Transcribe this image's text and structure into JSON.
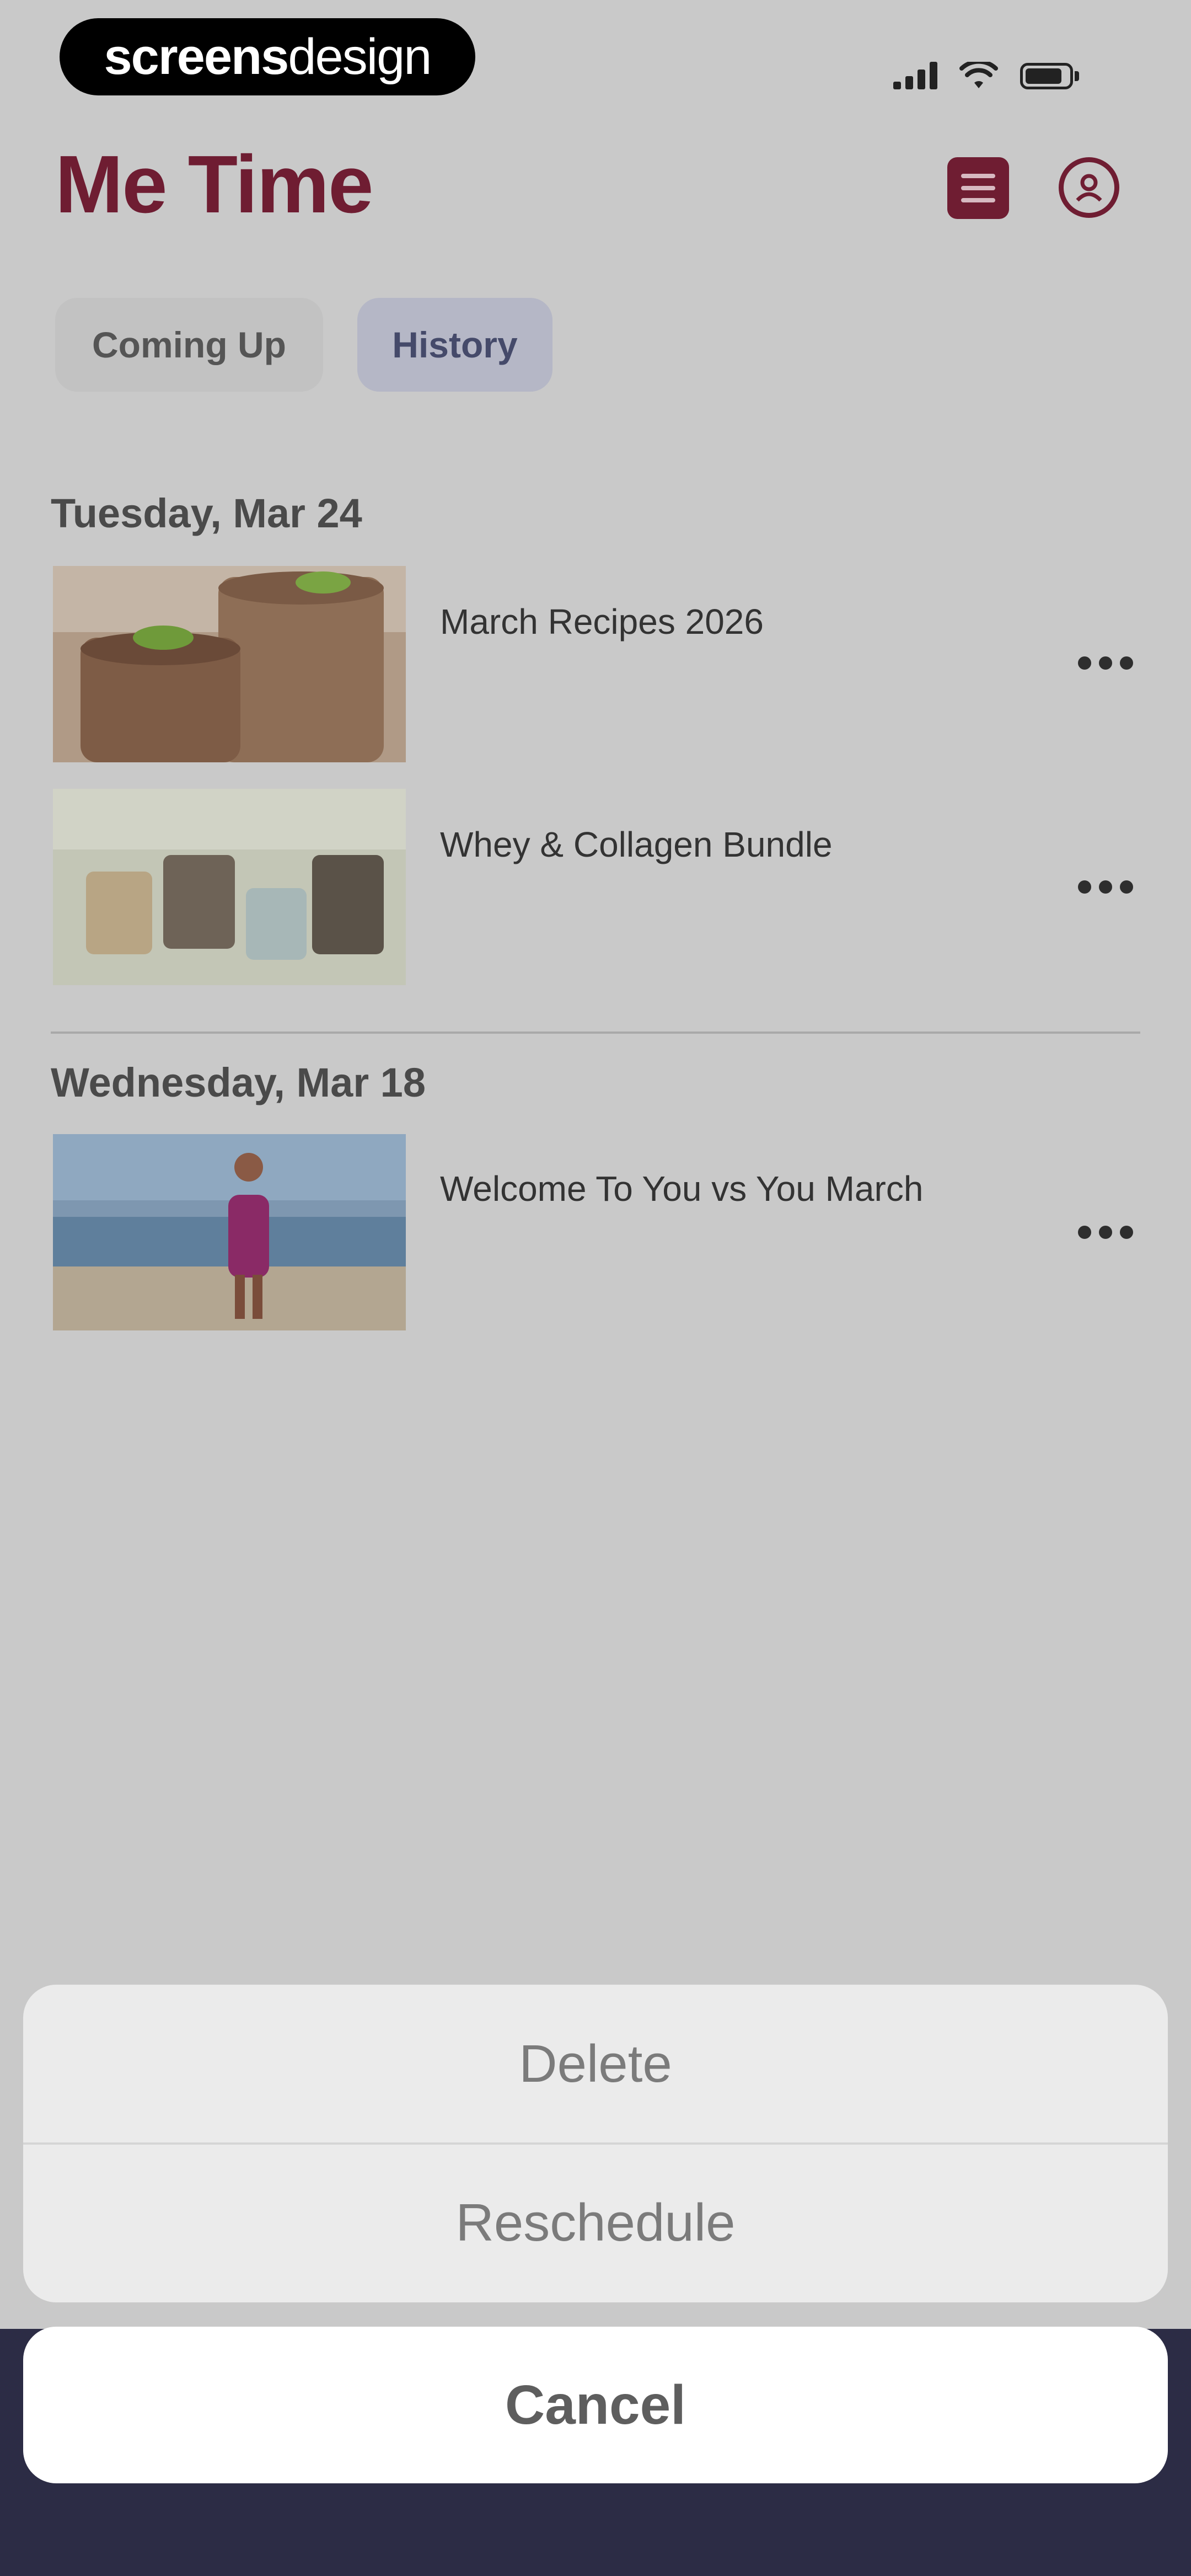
{
  "status_bar": {
    "brand_bold": "screens",
    "brand_regular": "design"
  },
  "header": {
    "title": "Me Time",
    "list_icon": "list-icon",
    "profile_icon": "profile-icon"
  },
  "tabs": [
    {
      "label": "Coming Up",
      "selected": false
    },
    {
      "label": "History",
      "selected": true
    }
  ],
  "sections": [
    {
      "date": "Tuesday, Mar 24",
      "items": [
        {
          "title": "March Recipes 2026",
          "thumb": "smoothie-photo"
        },
        {
          "title": "Whey & Collagen Bundle",
          "thumb": "protein-bags-photo"
        }
      ]
    },
    {
      "date": "Wednesday, Mar 18",
      "items": [
        {
          "title": "Welcome To You vs You March",
          "thumb": "beach-woman-photo"
        }
      ]
    }
  ],
  "action_sheet": {
    "delete": "Delete",
    "reschedule": "Reschedule",
    "cancel": "Cancel"
  },
  "colors": {
    "accent": "#6f1d32",
    "overlay": "#c9c9c9",
    "tabbar": "#2c2c45"
  }
}
